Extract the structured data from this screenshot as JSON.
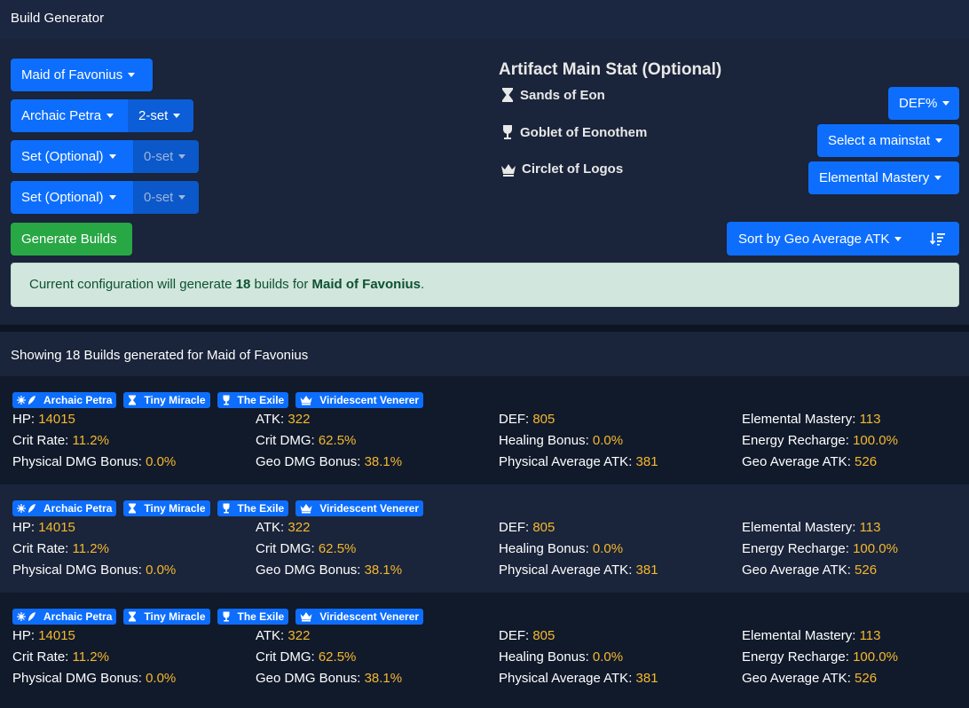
{
  "header": {
    "title": "Build Generator"
  },
  "controls": {
    "weapon": "Maid of Favonius",
    "sets": [
      {
        "name": "Archaic Petra",
        "count": "2-set",
        "disabled": false
      },
      {
        "name": "Set (Optional)",
        "count": "0-set",
        "disabled": true
      },
      {
        "name": "Set (Optional)",
        "count": "0-set",
        "disabled": true
      }
    ],
    "generate_label": "Generate Builds"
  },
  "artifact": {
    "title": "Artifact Main Stat (Optional)",
    "slots": [
      {
        "icon": "hourglass-icon",
        "name": "Sands of Eon",
        "value": "DEF%"
      },
      {
        "icon": "goblet-icon",
        "name": "Goblet of Eonothem",
        "value": "Select a mainstat"
      },
      {
        "icon": "crown-icon",
        "name": "Circlet of Logos",
        "value": "Elemental Mastery"
      }
    ],
    "sort_label": "Sort by Geo Average ATK"
  },
  "alert": {
    "prefix": "Current configuration will generate ",
    "count": "18",
    "middle": " builds for ",
    "weapon": "Maid of Favonius",
    "suffix": "."
  },
  "results": {
    "header": "Showing 18 Builds generated for Maid of Favonius",
    "builds": [
      {
        "badges": [
          {
            "icon": "flower-feather-icon",
            "label": "Archaic Petra"
          },
          {
            "icon": "hourglass-icon",
            "label": "Tiny Miracle"
          },
          {
            "icon": "goblet-icon",
            "label": "The Exile"
          },
          {
            "icon": "crown-icon",
            "label": "Viridescent Venerer"
          }
        ],
        "stats": {
          "hp": {
            "label": "HP:",
            "value": "14015"
          },
          "atk": {
            "label": "ATK:",
            "value": "322"
          },
          "def": {
            "label": "DEF:",
            "value": "805"
          },
          "em": {
            "label": "Elemental Mastery:",
            "value": "113"
          },
          "crit_rate": {
            "label": "Crit Rate:",
            "value": "11.2%"
          },
          "crit_dmg": {
            "label": "Crit DMG:",
            "value": "62.5%"
          },
          "healing": {
            "label": "Healing Bonus:",
            "value": "0.0%"
          },
          "er": {
            "label": "Energy Recharge:",
            "value": "100.0%"
          },
          "phys_dmg": {
            "label": "Physical DMG Bonus:",
            "value": "0.0%"
          },
          "geo_dmg": {
            "label": "Geo DMG Bonus:",
            "value": "38.1%"
          },
          "phys_avg": {
            "label": "Physical Average ATK:",
            "value": "381"
          },
          "geo_avg": {
            "label": "Geo Average ATK:",
            "value": "526"
          }
        }
      },
      {
        "badges": [
          {
            "icon": "flower-feather-icon",
            "label": "Archaic Petra"
          },
          {
            "icon": "hourglass-icon",
            "label": "Tiny Miracle"
          },
          {
            "icon": "goblet-icon",
            "label": "The Exile"
          },
          {
            "icon": "crown-icon",
            "label": "Viridescent Venerer"
          }
        ],
        "stats": {
          "hp": {
            "label": "HP:",
            "value": "14015"
          },
          "atk": {
            "label": "ATK:",
            "value": "322"
          },
          "def": {
            "label": "DEF:",
            "value": "805"
          },
          "em": {
            "label": "Elemental Mastery:",
            "value": "113"
          },
          "crit_rate": {
            "label": "Crit Rate:",
            "value": "11.2%"
          },
          "crit_dmg": {
            "label": "Crit DMG:",
            "value": "62.5%"
          },
          "healing": {
            "label": "Healing Bonus:",
            "value": "0.0%"
          },
          "er": {
            "label": "Energy Recharge:",
            "value": "100.0%"
          },
          "phys_dmg": {
            "label": "Physical DMG Bonus:",
            "value": "0.0%"
          },
          "geo_dmg": {
            "label": "Geo DMG Bonus:",
            "value": "38.1%"
          },
          "phys_avg": {
            "label": "Physical Average ATK:",
            "value": "381"
          },
          "geo_avg": {
            "label": "Geo Average ATK:",
            "value": "526"
          }
        }
      },
      {
        "badges": [
          {
            "icon": "flower-feather-icon",
            "label": "Archaic Petra"
          },
          {
            "icon": "hourglass-icon",
            "label": "Tiny Miracle"
          },
          {
            "icon": "goblet-icon",
            "label": "The Exile"
          },
          {
            "icon": "crown-icon",
            "label": "Viridescent Venerer"
          }
        ],
        "stats": {
          "hp": {
            "label": "HP:",
            "value": "14015"
          },
          "atk": {
            "label": "ATK:",
            "value": "322"
          },
          "def": {
            "label": "DEF:",
            "value": "805"
          },
          "em": {
            "label": "Elemental Mastery:",
            "value": "113"
          },
          "crit_rate": {
            "label": "Crit Rate:",
            "value": "11.2%"
          },
          "crit_dmg": {
            "label": "Crit DMG:",
            "value": "62.5%"
          },
          "healing": {
            "label": "Healing Bonus:",
            "value": "0.0%"
          },
          "er": {
            "label": "Energy Recharge:",
            "value": "100.0%"
          },
          "phys_dmg": {
            "label": "Physical DMG Bonus:",
            "value": "0.0%"
          },
          "geo_dmg": {
            "label": "Geo DMG Bonus:",
            "value": "38.1%"
          },
          "phys_avg": {
            "label": "Physical Average ATK:",
            "value": "381"
          },
          "geo_avg": {
            "label": "Geo Average ATK:",
            "value": "526"
          }
        }
      }
    ]
  },
  "colors": {
    "primary": "#0d6efd",
    "success": "#28a745",
    "stat_value": "#f5b82e",
    "panel": "#1a243a",
    "background": "#111a2b"
  }
}
